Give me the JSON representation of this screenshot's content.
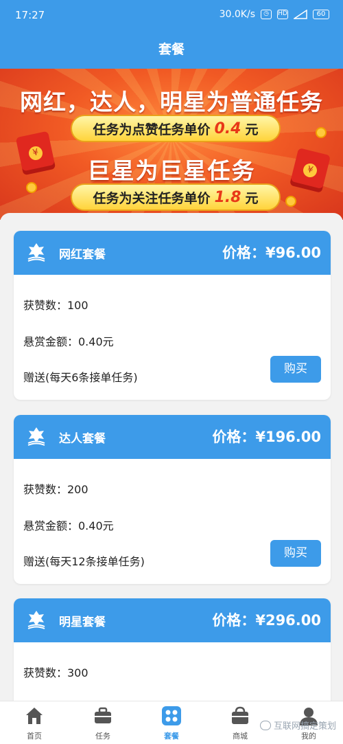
{
  "status_bar": {
    "time": "17:27",
    "net_speed": "30.0K/s",
    "hd_badge": "HD",
    "battery": "60"
  },
  "header": {
    "title": "套餐"
  },
  "banner": {
    "line1": "网红，达人，明星为普通任务",
    "line2_prefix": "任务为点赞任务单价",
    "line2_price": "0.4",
    "line2_unit": "元",
    "line3": "巨星为巨星任务",
    "line4_prefix": "任务为关注任务单价",
    "line4_price": "1.8",
    "line4_unit": "元"
  },
  "packages": [
    {
      "name": "网红套餐",
      "price": "价格：¥96.00",
      "likes": "获赞数：100",
      "reward": "悬赏金额：0.40元",
      "bonus": "赠送(每天6条接单任务)",
      "buy_label": "购买"
    },
    {
      "name": "达人套餐",
      "price": "价格：¥196.00",
      "likes": "获赞数：200",
      "reward": "悬赏金额：0.40元",
      "bonus": "赠送(每天12条接单任务)",
      "buy_label": "购买"
    },
    {
      "name": "明星套餐",
      "price": "价格：¥296.00",
      "likes": "获赞数：300"
    }
  ],
  "tabbar": {
    "items": [
      {
        "label": "首页",
        "icon": "home-icon"
      },
      {
        "label": "任务",
        "icon": "briefcase-icon"
      },
      {
        "label": "套餐",
        "icon": "grid-icon",
        "active": true
      },
      {
        "label": "商城",
        "icon": "shop-bag-icon"
      },
      {
        "label": "我的",
        "icon": "user-icon"
      }
    ]
  },
  "watermark": {
    "text": "互联网搞定策划"
  },
  "colors": {
    "primary": "#3d9be9",
    "banner_red": "#f15a24",
    "pill_yellow": "#ffd43b"
  }
}
